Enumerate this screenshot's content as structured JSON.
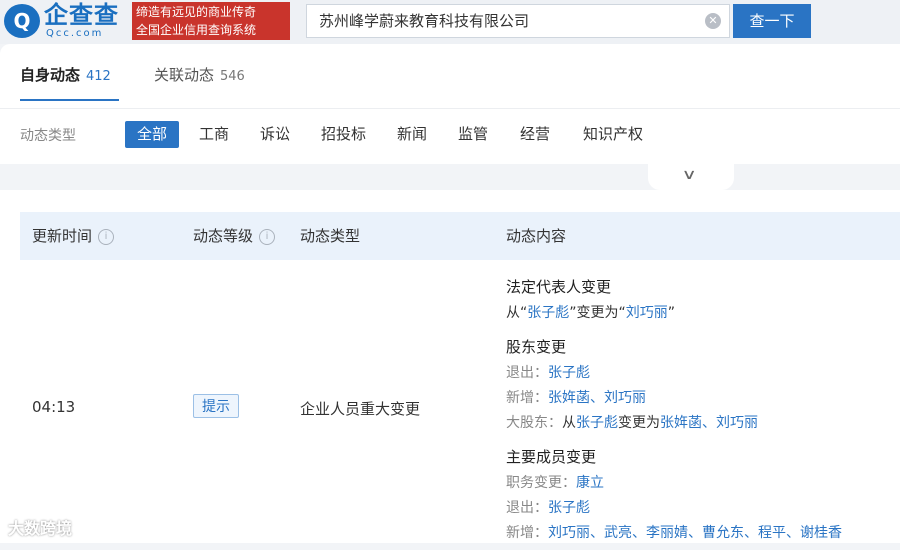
{
  "header": {
    "logo_glyph": "Q",
    "logo_main": "企查查",
    "logo_sub": "Qcc.com",
    "slogan_line1": "缔造有远见的商业传奇",
    "slogan_line2": "全国企业信用查询系统",
    "search_value": "苏州峰学蔚来教育科技有限公司",
    "search_button": "查一下"
  },
  "tabs": [
    {
      "label": "自身动态",
      "count": "412"
    },
    {
      "label": "关联动态",
      "count": "546"
    }
  ],
  "filter": {
    "label": "动态类型",
    "options": [
      "全部",
      "工商",
      "诉讼",
      "招投标",
      "新闻",
      "监管",
      "经营",
      "知识产权"
    ],
    "selected": "全部"
  },
  "table": {
    "headers": [
      "更新时间",
      "动态等级",
      "动态类型",
      "动态内容"
    ],
    "row": {
      "time": "04:13",
      "level": "提示",
      "type": "企业人员重大变更"
    }
  },
  "content": {
    "s1_title": "法定代表人变更",
    "s1_from_prefix": "从“",
    "s1_from_name": "张子彪",
    "s1_mid": "”变更为“",
    "s1_to_name": "刘巧丽",
    "s1_suffix": "”",
    "s2_title": "股东变更",
    "s2_exit_label": "退出：",
    "s2_exit_name": "张子彪",
    "s2_add_label": "新增：",
    "s2_add_names": "张姩菡、刘巧丽",
    "s2_major_label": "大股东：",
    "s2_major_from_word": "从",
    "s2_major_from": "张子彪",
    "s2_major_mid": "变更为",
    "s2_major_to": "张姩菡、刘巧丽",
    "s3_title": "主要成员变更",
    "s3_role_label": "职务变更：",
    "s3_role_name": "康立",
    "s3_exit_label": "退出：",
    "s3_exit_name": "张子彪",
    "s3_add_label": "新增：",
    "s3_add_names": "刘巧丽、武亮、李丽婧、曹允东、程平、谢桂香"
  },
  "watermark": "大数跨境",
  "icons": {
    "info": "info-icon",
    "chevron": "chevron-down-icon",
    "clear": "clear-icon"
  },
  "colors": {
    "accent": "#2a74c4",
    "slogan_bg": "#c9342c",
    "header_bg": "#eaf2fb"
  }
}
